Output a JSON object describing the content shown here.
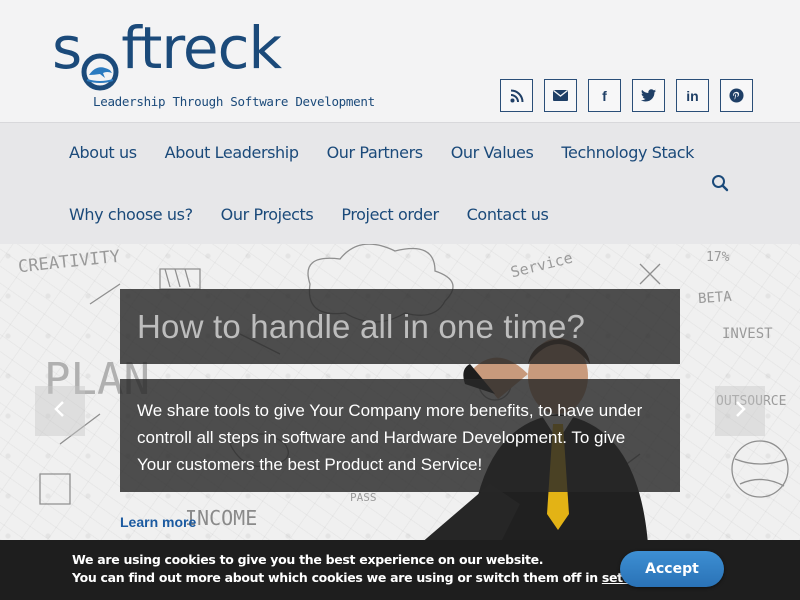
{
  "brand": {
    "name_before_o": "s",
    "name_after_o": "ftreck",
    "tagline": "Leadership Through Software Development",
    "color": "#1b4a7a"
  },
  "social": [
    {
      "icon": "rss-icon",
      "glyph": ""
    },
    {
      "icon": "mail-icon",
      "glyph": ""
    },
    {
      "icon": "facebook-icon",
      "glyph": "f"
    },
    {
      "icon": "twitter-icon",
      "glyph": ""
    },
    {
      "icon": "linkedin-icon",
      "glyph": "in"
    },
    {
      "icon": "pinterest-icon",
      "glyph": ""
    }
  ],
  "nav": {
    "row1": [
      "About us",
      "About Leadership",
      "Our Partners",
      "Our Values",
      "Technology Stack"
    ],
    "row2": [
      "Why choose us?",
      "Our Projects",
      "Project order",
      "Contact us"
    ],
    "search_icon": "search-icon"
  },
  "hero": {
    "title": "How to handle all in one time?",
    "body": "We share tools to give Your Company more benefits, to have under controll all steps in software and Hardware Development. To give Your customers the best Product and Service!",
    "learn_more": "Learn more",
    "doodles": [
      "CREATIVITY",
      "PLAN",
      "Service",
      "BETA",
      "INVEST",
      "OUTSOURCE",
      "INCOME",
      "PASS",
      "17%"
    ]
  },
  "cookie": {
    "line1": "We are using cookies to give you the best experience on our website.",
    "line2_prefix": "You can find out more about which cookies we are using or switch them off in ",
    "line2_link": "settings",
    "line2_suffix": ".",
    "accept": "Accept"
  }
}
